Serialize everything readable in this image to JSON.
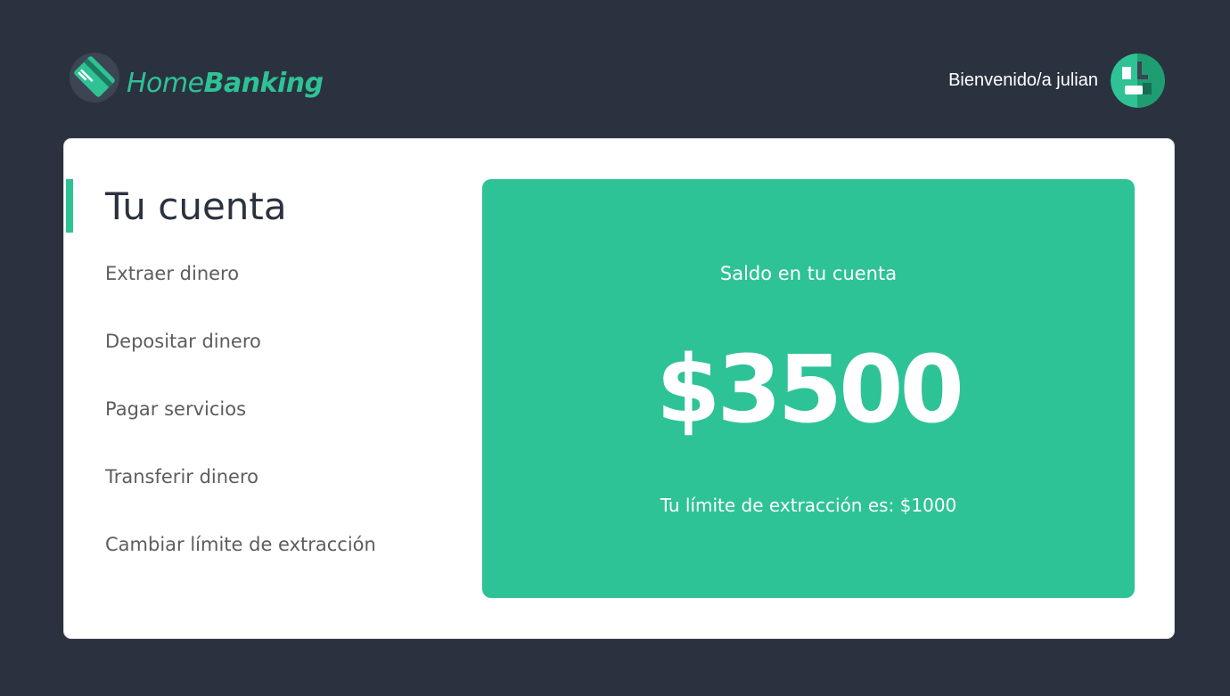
{
  "header": {
    "logo": {
      "icon": "credit-card-icon",
      "word_1": "Home",
      "word_2": "Banking",
      "color": "#2ec295"
    },
    "greeting": "Bienvenido/a julian",
    "avatar_icon": "user-avatar-icon"
  },
  "account": {
    "title": "Tu cuenta",
    "menu": [
      {
        "label": "Extraer dinero"
      },
      {
        "label": "Depositar dinero"
      },
      {
        "label": "Pagar servicios"
      },
      {
        "label": "Transferir dinero"
      },
      {
        "label": "Cambiar límite de extracción"
      }
    ]
  },
  "balance": {
    "label": "Saldo en tu cuenta",
    "amount": "$3500",
    "limit_text": "Tu límite de extracción es: $1000"
  },
  "colors": {
    "background": "#2b323f",
    "accent": "#2ec297",
    "card": "#ffffff",
    "menu_text": "#5d5d5d"
  }
}
